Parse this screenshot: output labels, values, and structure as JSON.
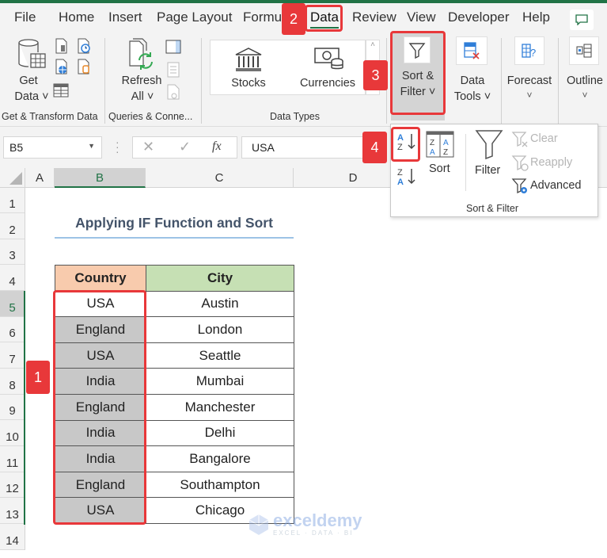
{
  "menu": {
    "tabs": [
      "File",
      "Home",
      "Insert",
      "Page Layout",
      "Formu",
      "Data",
      "Review",
      "View",
      "Developer",
      "Help"
    ],
    "active_tab": "Data"
  },
  "ribbon": {
    "get_transform": {
      "get_data": [
        "Get",
        "Data"
      ],
      "group_label": "Get & Transform Data"
    },
    "queries": {
      "refresh_all": [
        "Refresh",
        "All"
      ],
      "group_label": "Queries & Conne..."
    },
    "data_types": {
      "stocks": "Stocks",
      "currencies": "Currencies",
      "group_label": "Data Types"
    },
    "sort_filter": [
      "Sort &",
      "Filter"
    ],
    "data_tools": [
      "Data",
      "Tools"
    ],
    "forecast": "Forecast",
    "outline": "Outline"
  },
  "dropdown": {
    "sort_label": "Sort",
    "filter_label": "Filter",
    "clear_label": "Clear",
    "reapply_label": "Reapply",
    "advanced_label": "Advanced",
    "group_label": "Sort & Filter"
  },
  "formula_bar": {
    "name_box": "B5",
    "fx": "fx",
    "value": "USA"
  },
  "columns": [
    "A",
    "B",
    "C",
    "D"
  ],
  "rows": [
    "1",
    "2",
    "3",
    "4",
    "5",
    "6",
    "7",
    "8",
    "9",
    "10",
    "11",
    "12",
    "13",
    "14"
  ],
  "sheet": {
    "title": "Applying IF Function and Sort",
    "headers": [
      "Country",
      "City"
    ],
    "data": [
      [
        "USA",
        "Austin"
      ],
      [
        "England",
        "London"
      ],
      [
        "USA",
        "Seattle"
      ],
      [
        "India",
        "Mumbai"
      ],
      [
        "England",
        "Manchester"
      ],
      [
        "India",
        "Delhi"
      ],
      [
        "India",
        "Bangalore"
      ],
      [
        "England",
        "Southampton"
      ],
      [
        "USA",
        "Chicago"
      ]
    ]
  },
  "badges": [
    "1",
    "2",
    "3",
    "4"
  ],
  "watermark": {
    "name": "exceldemy",
    "tagline": "EXCEL · DATA · BI"
  },
  "colors": {
    "accent": "#217346",
    "badge": "#e8383a",
    "country_header": "#f8cbad",
    "city_header": "#c6e0b4"
  }
}
